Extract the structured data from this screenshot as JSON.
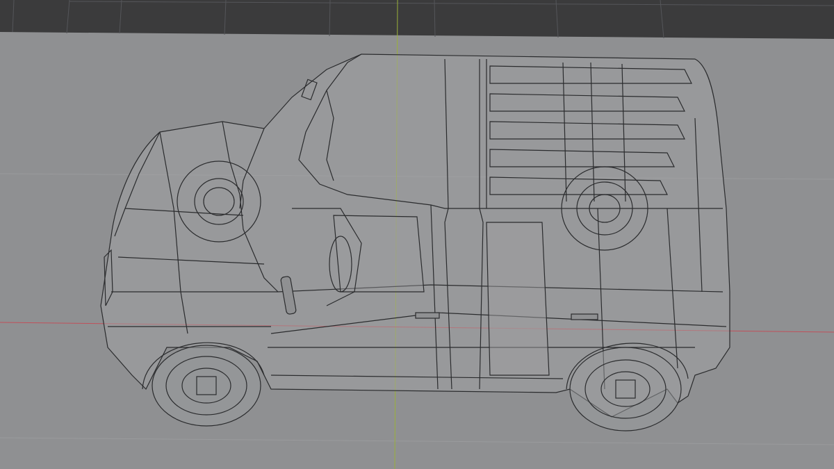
{
  "viewport": {
    "mode": "wireframe",
    "object": "van-mesh",
    "colors": {
      "background_dark": "#3b3b3c",
      "ground_plane": "#8f9092",
      "wire": "#2a2b2d",
      "x_axis": "#c0505a",
      "y_axis": "#9ab03a",
      "glass_fill": "#a3a4a6"
    }
  }
}
